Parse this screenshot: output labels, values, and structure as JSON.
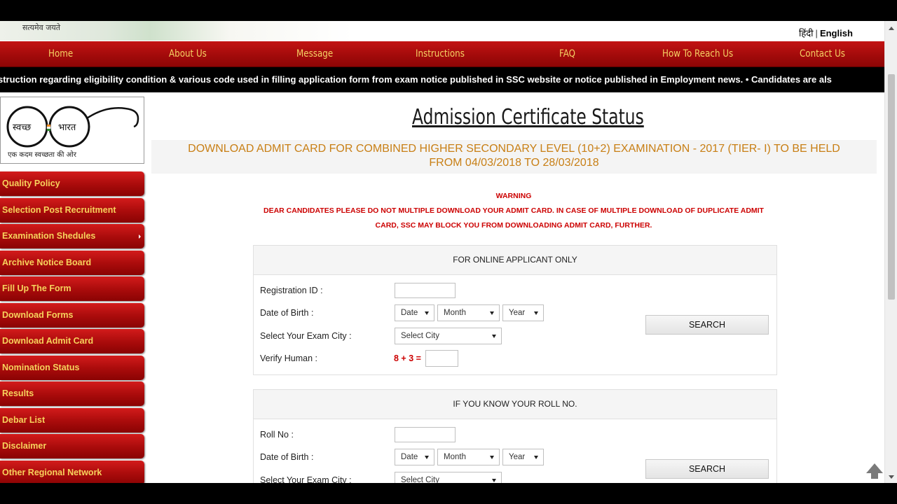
{
  "header": {
    "motto": "सत्यमेव जयते",
    "language": {
      "hindi": "हिंदी",
      "separator": "|",
      "english": "English"
    }
  },
  "nav": [
    "Home",
    "About Us",
    "Message",
    "Instructions",
    "FAQ",
    "How To Reach Us",
    "Contact Us"
  ],
  "ticker": "struction regarding eligibility condition & various code used in filling application form from exam notice published in SSC website or notice published in Employment news.  • Candidates are als",
  "logo": {
    "left_word": "स्वच्छ",
    "right_word": "भारत",
    "caption": "एक कदम स्वच्छता की ओर"
  },
  "sidebar": [
    "Quality Policy",
    "Selection Post Recruitment",
    "Examination Shedules",
    "Archive Notice Board",
    "Fill Up The Form",
    "Download Forms",
    "Download Admit Card",
    "Nomination Status",
    "Results",
    "Debar List",
    "Disclaimer",
    "Other Regional Network"
  ],
  "page": {
    "title": "Admission Certificate Status",
    "exam_line1": "DOWNLOAD ADMIT CARD FOR COMBINED HIGHER SECONDARY LEVEL (10+2) EXAMINATION - 2017 (TIER- I) TO BE HELD",
    "exam_line2": "FROM 04/03/2018 TO 28/03/2018"
  },
  "warning": {
    "title": "WARNING",
    "line1": "DEAR CANDIDATES PLEASE DO NOT MULTIPLE DOWNLOAD YOUR ADMIT CARD. IN CASE OF MULTIPLE DOWNLOAD OF DUPLICATE ADMIT",
    "line2": "CARD, SSC MAY BLOCK YOU FROM DOWNLOADING ADMIT CARD, FURTHER."
  },
  "online_form": {
    "heading": "FOR ONLINE APPLICANT ONLY",
    "registration_label": "Registration ID :",
    "registration_value": "",
    "dob_label": "Date of Birth :",
    "date": "Date",
    "month": "Month",
    "year": "Year",
    "city_label": "Select Your Exam City :",
    "city": "Select City",
    "verify_label": "Verify Human :",
    "captcha": "8 + 3 =",
    "captcha_value": "",
    "search": "SEARCH"
  },
  "roll_form": {
    "heading": "IF YOU KNOW YOUR ROLL NO.",
    "roll_label": "Roll No :",
    "roll_value": "",
    "dob_label": "Date of Birth :",
    "date": "Date",
    "month": "Month",
    "year": "Year",
    "city_label": "Select Your Exam City :",
    "city": "Select City",
    "search": "SEARCH"
  }
}
